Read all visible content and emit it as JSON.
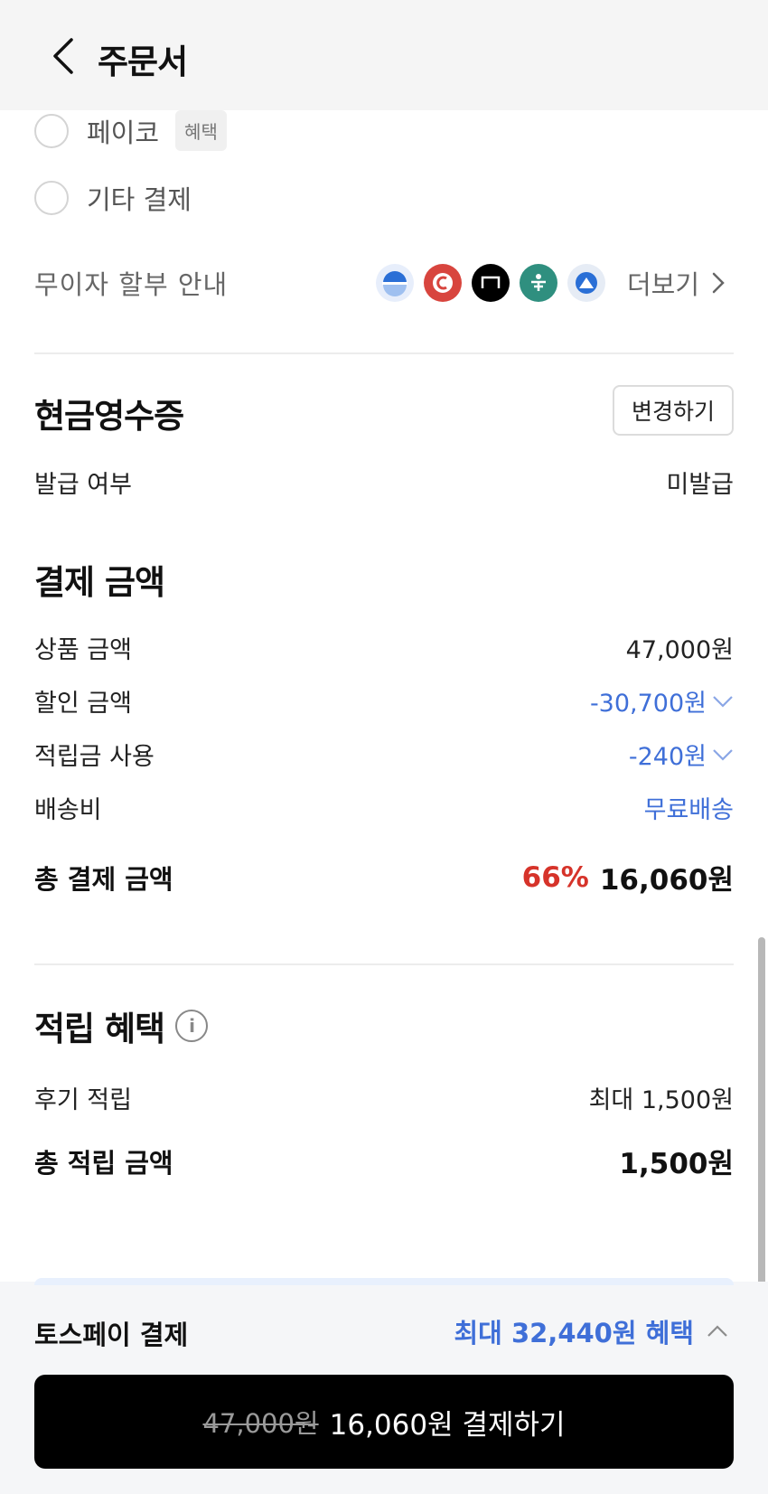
{
  "header": {
    "title": "주문서"
  },
  "payment_options": [
    {
      "label": "페이코",
      "tag": "혜택"
    },
    {
      "label": "기타 결제"
    }
  ],
  "installment": {
    "label": "무이자 할부 안내",
    "more_label": "더보기",
    "cards": [
      {
        "icon": "shinhan-card-icon",
        "color": "#e7eefb"
      },
      {
        "icon": "lotte-card-icon",
        "color": "#d8453e"
      },
      {
        "icon": "hyundai-card-icon",
        "color": "#000000"
      },
      {
        "icon": "hana-card-icon",
        "color": "#2f8f7f"
      },
      {
        "icon": "woori-card-icon",
        "color": "#e6ecf5"
      }
    ]
  },
  "cash_receipt": {
    "title": "현금영수증",
    "change_label": "변경하기",
    "issue_label": "발급 여부",
    "issue_value": "미발급"
  },
  "payment_amount": {
    "title": "결제 금액",
    "rows": [
      {
        "label": "상품 금액",
        "value": "47,000원"
      },
      {
        "label": "할인 금액",
        "value": "-30,700원"
      },
      {
        "label": "적립금 사용",
        "value": "-240원"
      },
      {
        "label": "배송비",
        "value": "무료배송"
      }
    ],
    "total_label": "총 결제 금액",
    "total_percent": "66%",
    "total_value": "16,060원"
  },
  "reward": {
    "title": "적립 혜택",
    "review_label": "후기 적립",
    "review_value": "최대 1,500원",
    "total_label": "총 적립 금액",
    "total_value": "1,500원"
  },
  "bottom": {
    "toss_label": "토스페이 결제",
    "toss_benefit": "최대 32,440원 혜택",
    "original_price": "47,000원",
    "final_label": "16,060원 결제하기"
  },
  "colors": {
    "accent_blue": "#3f6fd8",
    "discount_red": "#d6332a",
    "button_black": "#000000"
  }
}
